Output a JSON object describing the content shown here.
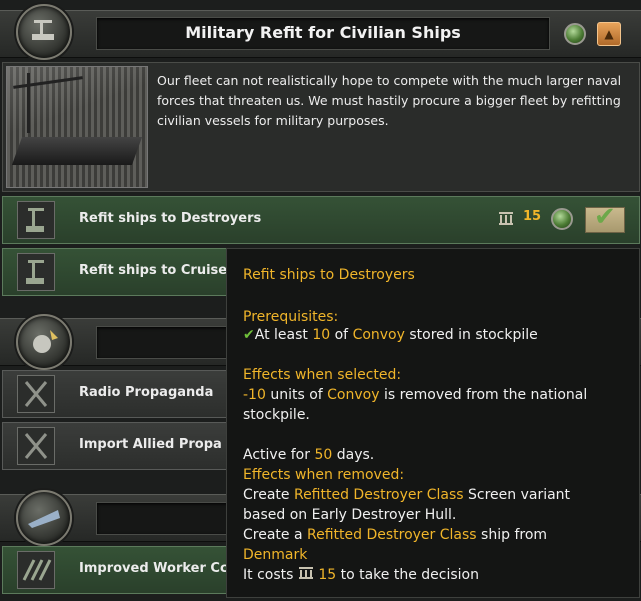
{
  "category": {
    "title": "Military Refit for Civilian Ships",
    "description": "Our fleet can not realistically hope to compete with the much larger naval forces that threaten us. We must hastily procure a bigger fleet by refitting civilian vessels for military purposes.",
    "collapse_icon": "chevron-up-icon"
  },
  "decisions": [
    {
      "label": "Refit ships to Destroyers",
      "cost": "15",
      "cost_icon": "political-power-icon",
      "status_icon": "green-light-icon",
      "action_icon": "envelope-check-icon"
    },
    {
      "label": "Refit ships to Cruise"
    }
  ],
  "category2": {
    "title": ""
  },
  "decisions2": [
    {
      "label": "Radio Propaganda"
    },
    {
      "label": "Import Allied Propa"
    }
  ],
  "category3": {
    "title": ""
  },
  "decisions3": [
    {
      "label": "Improved Worker Cc"
    }
  ],
  "tooltip": {
    "title": "Refit ships to Destroyers",
    "prereq_heading": "Prerequisites:",
    "prereq_check": "✔",
    "prereq_text_1": "At least ",
    "prereq_amount": "10",
    "prereq_text_2": " of ",
    "prereq_item": "Convoy",
    "prereq_text_3": " stored in stockpile",
    "effects_selected_heading": "Effects when selected:",
    "effect_amount": "-10",
    "effect_text_1": " units of ",
    "effect_item": "Convoy",
    "effect_text_2": " is removed from the national",
    "effect_text_3": "stockpile.",
    "active_text_1": "Active for ",
    "active_days": "50",
    "active_text_2": " days.",
    "effects_removed_heading": "Effects when removed:",
    "removed_text_1": "Create ",
    "removed_class": "Refitted Destroyer Class",
    "removed_text_2": " Screen variant",
    "removed_text_3": "based on Early Destroyer Hull.",
    "removed_text_4": "Create a ",
    "removed_class2": "Refitted Destroyer Class",
    "removed_text_5": " ship from",
    "removed_country": "Denmark",
    "cost_text_1": "It costs ",
    "cost_amount": "15",
    "cost_text_2": " to take the decision"
  },
  "colors": {
    "highlight": "#f0b52a",
    "check_green": "#6fbf3a",
    "row_green": "#355236"
  }
}
